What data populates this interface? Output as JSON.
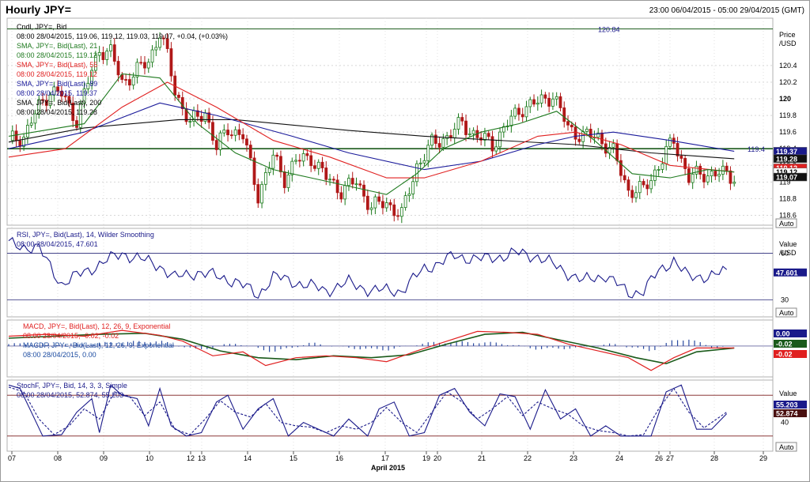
{
  "header": {
    "title": "Hourly JPY=",
    "date_range": "23:00 06/04/2015 - 05:00 29/04/2015 (GMT)"
  },
  "colors": {
    "price_up": "#1a7a1a",
    "price_down": "#b01818",
    "sma21": "#1f7a1f",
    "sma55": "#e02020",
    "sma89": "#1a1a9a",
    "sma200": "#111111",
    "rsi": "#1a1a8a",
    "macd": "#e02020",
    "macd_signal": "#1a5a1a",
    "macd_hist": "#2a4aa0",
    "stoch_k": "#1a1a8a",
    "stoch_d": "#1a1a8a"
  },
  "x_axis": {
    "labels": [
      "07",
      "08",
      "09",
      "10",
      "12",
      "13",
      "14",
      "15",
      "16",
      "17",
      "19",
      "20",
      "21",
      "22",
      "23",
      "24",
      "26",
      "27",
      "28",
      "29"
    ],
    "month_label": "April 2015"
  },
  "price_panel": {
    "legend": [
      "Cndl, JPY=, Bid",
      "08:00 28/04/2015, 119.06, 119.12, 119.03, 119.07, +0.04, (+0.03%)",
      "SMA, JPY=, Bid(Last), 21",
      "08:00 28/04/2015, 119.12",
      "SMA, JPY=, Bid(Last), 55",
      "08:00 28/04/2015, 119.12",
      "SMA, JPY=, Bid(Last), 89",
      "08:00 28/04/2015, 119.37",
      "SMA, JPY=, Bid(Last), 200",
      "08:00 28/04/2015, 119.28"
    ],
    "axis_title": "Price",
    "axis_unit": "/USD",
    "ticks": [
      "120.4",
      "120.2",
      "120",
      "119.8",
      "119.6",
      "119.4",
      "119.2",
      "119",
      "118.8",
      "118.6"
    ],
    "auto": "Auto",
    "levels": [
      {
        "label": "120.84",
        "value": 120.84
      },
      {
        "label": "119.4",
        "value": 119.4
      }
    ],
    "tags": [
      {
        "text": "119.37",
        "value": 119.37,
        "bg": "#1a1a8a",
        "fg": "#ffffff"
      },
      {
        "text": "119.28",
        "value": 119.28,
        "bg": "#111111",
        "fg": "#ffffff"
      },
      {
        "text": "119.12",
        "value": 119.17,
        "bg": "#e02020",
        "fg": "#ffffff"
      },
      {
        "text": "119.12",
        "value": 119.12,
        "bg": "#ffffff",
        "fg": "#000000"
      },
      {
        "text": "119.07",
        "value": 119.06,
        "bg": "#111111",
        "fg": "#ffffff"
      }
    ]
  },
  "rsi_panel": {
    "legend": [
      "RSI, JPY=, Bid(Last), 14, Wilder Smoothing",
      "08:00 28/04/2015, 47.601"
    ],
    "axis_title": "Value",
    "axis_unit": "/USD",
    "ticks": [
      "60",
      "30"
    ],
    "tag": "47.601",
    "auto": "Auto"
  },
  "macd_panel": {
    "legend": [
      "MACD, JPY=, Bid(Last), 12, 26, 9, Exponential",
      "08:00 28/04/2015, -0.02, -0.02",
      "MACDF, JPY=, Bid(Last), 12, 26, 9, Exponential",
      "08:00 28/04/2015, 0.00"
    ],
    "tags": [
      "0.00",
      "-0.02",
      "-0.02"
    ]
  },
  "stoch_panel": {
    "legend": [
      "StochF, JPY=, Bid, 14, 3, 3, Simple",
      "08:00 28/04/2015, 52.874, 55.203"
    ],
    "axis_title": "Value",
    "ticks": [
      "40"
    ],
    "tags": [
      "55.203",
      "52.874"
    ],
    "auto": "Auto"
  },
  "chart_data": [
    {
      "type": "candlestick",
      "title": "Hourly JPY=",
      "ylim": [
        118.5,
        120.95
      ],
      "close_path": [
        [
          0,
          119.5
        ],
        [
          4,
          119.55
        ],
        [
          8,
          119.9
        ],
        [
          11,
          120.1
        ],
        [
          14,
          120.05
        ],
        [
          18,
          119.75
        ],
        [
          21,
          120.2
        ],
        [
          24,
          120.6
        ],
        [
          27,
          120.55
        ],
        [
          30,
          120.2
        ],
        [
          33,
          120.3
        ],
        [
          37,
          120.45
        ],
        [
          40,
          120.8
        ],
        [
          42,
          120.5
        ],
        [
          44,
          120.1
        ],
        [
          48,
          119.7
        ],
        [
          52,
          119.85
        ],
        [
          55,
          119.4
        ],
        [
          58,
          119.65
        ],
        [
          62,
          119.55
        ],
        [
          66,
          118.85
        ],
        [
          70,
          119.3
        ],
        [
          73,
          119.05
        ],
        [
          76,
          119.25
        ],
        [
          80,
          119.3
        ],
        [
          84,
          119.05
        ],
        [
          88,
          118.9
        ],
        [
          92,
          119.0
        ],
        [
          96,
          118.7
        ],
        [
          100,
          118.75
        ],
        [
          104,
          118.6
        ],
        [
          108,
          119.2
        ],
        [
          112,
          119.45
        ],
        [
          116,
          119.55
        ],
        [
          120,
          119.7
        ],
        [
          124,
          119.55
        ],
        [
          128,
          119.45
        ],
        [
          132,
          119.7
        ],
        [
          136,
          119.9
        ],
        [
          140,
          119.95
        ],
        [
          144,
          120.05
        ],
        [
          148,
          119.65
        ],
        [
          152,
          119.55
        ],
        [
          156,
          119.55
        ],
        [
          160,
          119.35
        ],
        [
          164,
          118.9
        ],
        [
          168,
          118.9
        ],
        [
          172,
          119.2
        ],
        [
          176,
          119.5
        ],
        [
          180,
          119.05
        ],
        [
          184,
          119.1
        ],
        [
          188,
          119.1
        ],
        [
          192,
          119.07
        ]
      ],
      "sma21": [
        [
          0,
          119.55
        ],
        [
          20,
          119.7
        ],
        [
          30,
          120.3
        ],
        [
          40,
          120.25
        ],
        [
          50,
          119.7
        ],
        [
          60,
          119.35
        ],
        [
          70,
          119.15
        ],
        [
          80,
          119.05
        ],
        [
          90,
          118.95
        ],
        [
          100,
          118.85
        ],
        [
          108,
          119.1
        ],
        [
          115,
          119.4
        ],
        [
          125,
          119.6
        ],
        [
          135,
          119.7
        ],
        [
          145,
          119.85
        ],
        [
          155,
          119.5
        ],
        [
          165,
          119.1
        ],
        [
          175,
          119.05
        ],
        [
          185,
          119.15
        ],
        [
          192,
          119.12
        ]
      ],
      "sma55": [
        [
          0,
          119.3
        ],
        [
          15,
          119.4
        ],
        [
          30,
          119.9
        ],
        [
          42,
          120.2
        ],
        [
          55,
          119.9
        ],
        [
          70,
          119.5
        ],
        [
          85,
          119.3
        ],
        [
          100,
          119.05
        ],
        [
          110,
          119.05
        ],
        [
          125,
          119.25
        ],
        [
          140,
          119.55
        ],
        [
          150,
          119.6
        ],
        [
          162,
          119.45
        ],
        [
          175,
          119.2
        ],
        [
          192,
          119.12
        ]
      ],
      "sma89": [
        [
          0,
          119.4
        ],
        [
          20,
          119.6
        ],
        [
          40,
          119.95
        ],
        [
          55,
          119.8
        ],
        [
          75,
          119.55
        ],
        [
          90,
          119.35
        ],
        [
          110,
          119.15
        ],
        [
          125,
          119.25
        ],
        [
          140,
          119.45
        ],
        [
          150,
          119.55
        ],
        [
          160,
          119.6
        ],
        [
          175,
          119.5
        ],
        [
          192,
          119.37
        ]
      ],
      "sma200": [
        [
          0,
          119.48
        ],
        [
          20,
          119.65
        ],
        [
          45,
          119.75
        ],
        [
          60,
          119.75
        ],
        [
          90,
          119.62
        ],
        [
          110,
          119.55
        ],
        [
          130,
          119.5
        ],
        [
          150,
          119.45
        ],
        [
          170,
          119.35
        ],
        [
          192,
          119.28
        ]
      ]
    },
    {
      "type": "line",
      "name": "RSI",
      "ylim": [
        20,
        75
      ],
      "points": [
        [
          0,
          66
        ],
        [
          8,
          63
        ],
        [
          14,
          40
        ],
        [
          20,
          48
        ],
        [
          30,
          60
        ],
        [
          40,
          52
        ],
        [
          44,
          44
        ],
        [
          50,
          48
        ],
        [
          60,
          42
        ],
        [
          66,
          33
        ],
        [
          70,
          45
        ],
        [
          78,
          40
        ],
        [
          84,
          36
        ],
        [
          90,
          41
        ],
        [
          96,
          36
        ],
        [
          104,
          36
        ],
        [
          110,
          50
        ],
        [
          118,
          58
        ],
        [
          126,
          56
        ],
        [
          134,
          60
        ],
        [
          140,
          58
        ],
        [
          146,
          50
        ],
        [
          152,
          42
        ],
        [
          158,
          46
        ],
        [
          164,
          34
        ],
        [
          168,
          36
        ],
        [
          172,
          48
        ],
        [
          176,
          56
        ],
        [
          180,
          44
        ],
        [
          186,
          46
        ],
        [
          190,
          47.601
        ]
      ]
    },
    {
      "type": "line",
      "name": "MACD",
      "ylim": [
        -0.3,
        0.25
      ],
      "macd": [
        [
          0,
          0.1
        ],
        [
          10,
          0.12
        ],
        [
          20,
          0.1
        ],
        [
          30,
          0.16
        ],
        [
          40,
          0.11
        ],
        [
          46,
          0.05
        ],
        [
          54,
          -0.1
        ],
        [
          62,
          -0.06
        ],
        [
          68,
          -0.2
        ],
        [
          76,
          -0.12
        ],
        [
          84,
          -0.1
        ],
        [
          92,
          -0.12
        ],
        [
          100,
          -0.16
        ],
        [
          108,
          -0.05
        ],
        [
          116,
          0.05
        ],
        [
          124,
          0.15
        ],
        [
          132,
          0.14
        ],
        [
          140,
          0.12
        ],
        [
          148,
          0.02
        ],
        [
          156,
          -0.05
        ],
        [
          164,
          -0.12
        ],
        [
          170,
          -0.25
        ],
        [
          176,
          -0.12
        ],
        [
          182,
          -0.02
        ],
        [
          192,
          -0.02
        ]
      ],
      "signal": [
        [
          0,
          0.08
        ],
        [
          12,
          0.1
        ],
        [
          24,
          0.12
        ],
        [
          36,
          0.13
        ],
        [
          46,
          0.07
        ],
        [
          56,
          -0.05
        ],
        [
          66,
          -0.12
        ],
        [
          76,
          -0.14
        ],
        [
          86,
          -0.1
        ],
        [
          96,
          -0.12
        ],
        [
          106,
          -0.09
        ],
        [
          116,
          0.02
        ],
        [
          126,
          0.12
        ],
        [
          136,
          0.14
        ],
        [
          146,
          0.06
        ],
        [
          156,
          -0.02
        ],
        [
          166,
          -0.12
        ],
        [
          174,
          -0.18
        ],
        [
          182,
          -0.06
        ],
        [
          192,
          -0.02
        ]
      ],
      "hist": [
        [
          20,
          0.02
        ],
        [
          30,
          0.04
        ],
        [
          40,
          0.05
        ],
        [
          50,
          -0.04
        ],
        [
          60,
          0.03
        ],
        [
          70,
          -0.06
        ],
        [
          80,
          0.03
        ],
        [
          90,
          -0.02
        ],
        [
          100,
          -0.04
        ],
        [
          110,
          0.03
        ],
        [
          120,
          0.04
        ],
        [
          130,
          0.03
        ],
        [
          140,
          -0.03
        ],
        [
          150,
          -0.02
        ],
        [
          160,
          0.02
        ],
        [
          170,
          -0.05
        ],
        [
          176,
          0.06
        ],
        [
          180,
          0.07
        ],
        [
          186,
          -0.01
        ]
      ]
    },
    {
      "type": "line",
      "name": "StochF",
      "ylim": [
        0,
        100
      ],
      "k": [
        [
          0,
          95
        ],
        [
          3,
          90
        ],
        [
          6,
          55
        ],
        [
          9,
          20
        ],
        [
          14,
          22
        ],
        [
          18,
          55
        ],
        [
          22,
          75
        ],
        [
          24,
          25
        ],
        [
          27,
          95
        ],
        [
          30,
          80
        ],
        [
          34,
          75
        ],
        [
          37,
          35
        ],
        [
          40,
          90
        ],
        [
          43,
          35
        ],
        [
          47,
          20
        ],
        [
          51,
          25
        ],
        [
          55,
          70
        ],
        [
          58,
          80
        ],
        [
          62,
          30
        ],
        [
          66,
          60
        ],
        [
          70,
          75
        ],
        [
          74,
          20
        ],
        [
          78,
          40
        ],
        [
          82,
          30
        ],
        [
          86,
          20
        ],
        [
          90,
          45
        ],
        [
          95,
          20
        ],
        [
          98,
          60
        ],
        [
          102,
          70
        ],
        [
          106,
          20
        ],
        [
          110,
          25
        ],
        [
          114,
          80
        ],
        [
          118,
          90
        ],
        [
          122,
          55
        ],
        [
          126,
          35
        ],
        [
          130,
          82
        ],
        [
          134,
          78
        ],
        [
          138,
          30
        ],
        [
          142,
          88
        ],
        [
          146,
          45
        ],
        [
          150,
          60
        ],
        [
          154,
          20
        ],
        [
          158,
          35
        ],
        [
          162,
          20
        ],
        [
          166,
          20
        ],
        [
          170,
          20
        ],
        [
          174,
          85
        ],
        [
          178,
          95
        ],
        [
          182,
          30
        ],
        [
          186,
          30
        ],
        [
          190,
          52.874
        ]
      ],
      "d": [
        [
          0,
          92
        ],
        [
          4,
          85
        ],
        [
          8,
          45
        ],
        [
          12,
          22
        ],
        [
          16,
          35
        ],
        [
          20,
          60
        ],
        [
          24,
          45
        ],
        [
          28,
          85
        ],
        [
          32,
          78
        ],
        [
          36,
          50
        ],
        [
          40,
          70
        ],
        [
          44,
          30
        ],
        [
          48,
          22
        ],
        [
          52,
          45
        ],
        [
          56,
          72
        ],
        [
          60,
          55
        ],
        [
          64,
          48
        ],
        [
          68,
          68
        ],
        [
          72,
          40
        ],
        [
          76,
          35
        ],
        [
          80,
          33
        ],
        [
          84,
          25
        ],
        [
          88,
          35
        ],
        [
          92,
          30
        ],
        [
          96,
          40
        ],
        [
          100,
          62
        ],
        [
          104,
          40
        ],
        [
          108,
          25
        ],
        [
          112,
          55
        ],
        [
          116,
          85
        ],
        [
          120,
          70
        ],
        [
          124,
          45
        ],
        [
          128,
          60
        ],
        [
          132,
          78
        ],
        [
          136,
          50
        ],
        [
          140,
          70
        ],
        [
          144,
          60
        ],
        [
          148,
          52
        ],
        [
          152,
          35
        ],
        [
          156,
          28
        ],
        [
          160,
          25
        ],
        [
          164,
          20
        ],
        [
          168,
          22
        ],
        [
          172,
          60
        ],
        [
          176,
          90
        ],
        [
          180,
          55
        ],
        [
          184,
          32
        ],
        [
          190,
          55.203
        ]
      ]
    }
  ]
}
